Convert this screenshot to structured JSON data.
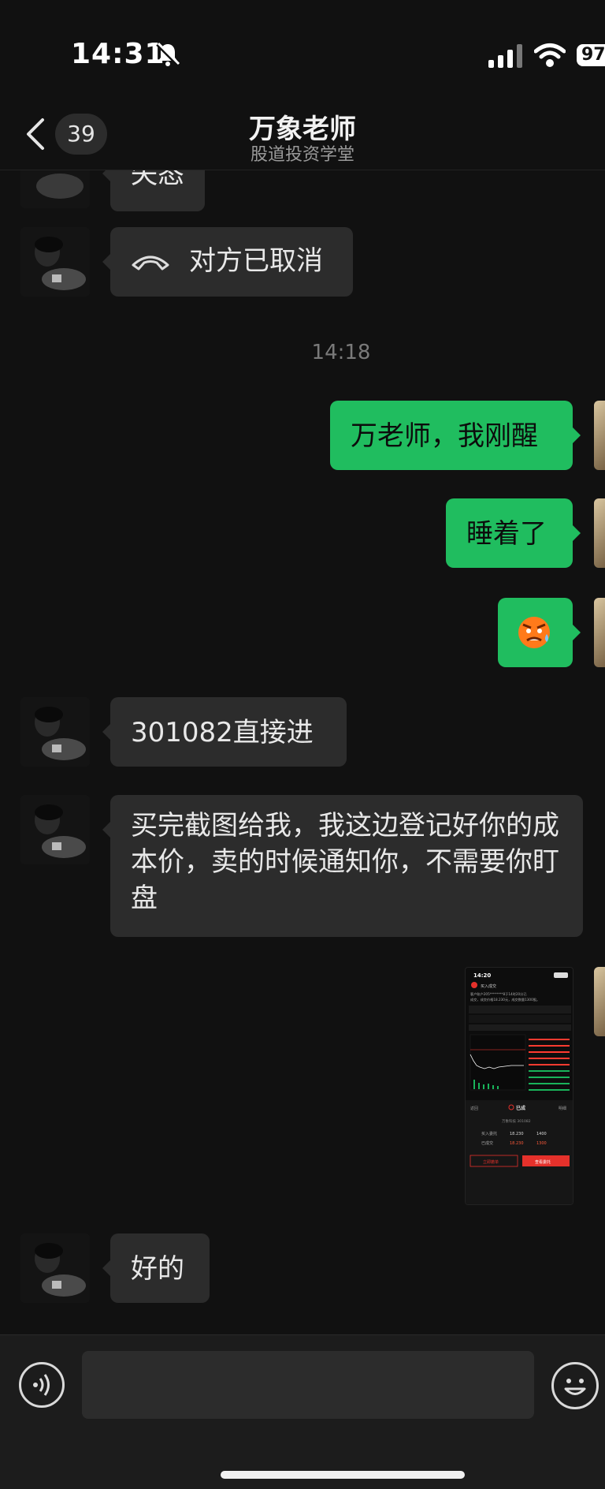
{
  "status_bar": {
    "time": "14:31",
    "battery": "97"
  },
  "header": {
    "back_count": "39",
    "title": "万象老师",
    "subtitle": "股道投资学堂"
  },
  "messages": [
    {
      "from": "contact",
      "text": "失态"
    },
    {
      "from": "contact",
      "type": "call",
      "text": "对方已取消"
    },
    {
      "type": "time",
      "text": "14:18"
    },
    {
      "from": "me",
      "text": "万老师，我刚醒"
    },
    {
      "from": "me",
      "text": "睡着了"
    },
    {
      "from": "me",
      "type": "emoji",
      "icon": "sweating-face-emoji"
    },
    {
      "from": "contact",
      "text": "301082直接进"
    },
    {
      "from": "contact",
      "text": "买完截图给我，我这边登记好你的成本价，卖的时候通知你，不需要你盯盘"
    },
    {
      "from": "me",
      "type": "image"
    },
    {
      "from": "contact",
      "text": "好的"
    }
  ],
  "shared_screenshot": {
    "time": "14:20",
    "header_label": "买入成交",
    "notice_line1": "客户账户205********8于14时20分已",
    "notice_line2": "成交，成交价格18.230元，成交数量1300股。",
    "filled_title": "已成",
    "back_label": "返回",
    "detail_label": "明细",
    "stock_line": "万象科技 301082",
    "buy_price_label": "买入委托",
    "buy_price": "18.230",
    "buy_qty": "1400",
    "filled_label": "已成交",
    "filled_price": "18.230",
    "filled_qty": "1300",
    "cancel_btn": "立即撤单",
    "view_btn": "查看委托"
  },
  "input": {
    "placeholder": ""
  },
  "colors": {
    "outgoing_bubble": "#20bd5f",
    "incoming_bubble": "#2c2c2c",
    "background": "#111111"
  }
}
